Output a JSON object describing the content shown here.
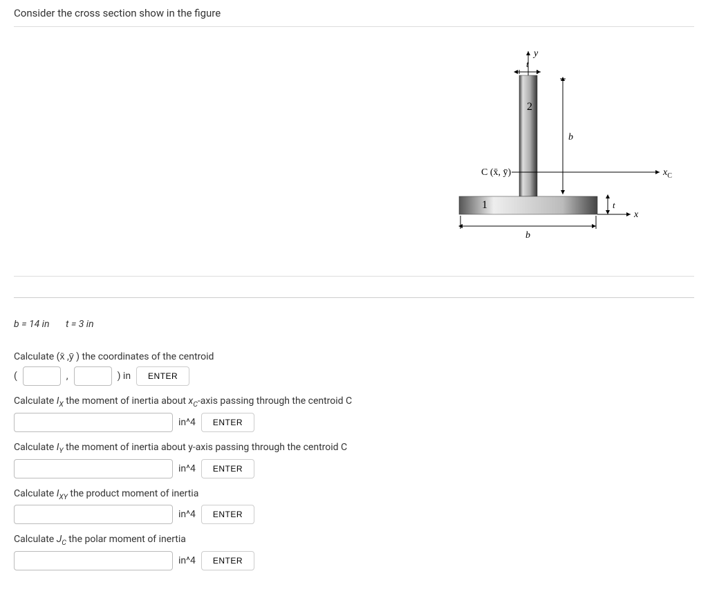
{
  "title": "Consider the cross section show in the figure",
  "given": {
    "b": "b = 14 in",
    "t": "t = 3 in"
  },
  "q1": {
    "prompt": "Calculate (x̄ ,ȳ ) the coordinates of the centroid",
    "open": "(",
    "comma": ",",
    "close": ") in",
    "enter": "ENTER"
  },
  "q2": {
    "prompt_a": "Calculate ",
    "prompt_b": "I",
    "prompt_c": "X",
    "prompt_d": " the moment of inertia about ",
    "prompt_e": "x",
    "prompt_f": "C",
    "prompt_g": "-axis passing through the centroid C",
    "unit": "in^4",
    "enter": "ENTER"
  },
  "q3": {
    "prompt_a": "Calculate ",
    "prompt_b": "I",
    "prompt_c": "Y",
    "prompt_d": " the moment of inertia about y-axis passing through the centroid C",
    "unit": "in^4",
    "enter": "ENTER"
  },
  "q4": {
    "prompt_a": "Calculate ",
    "prompt_b": "I",
    "prompt_c": "XY",
    "prompt_d": " the product moment of inertia",
    "unit": "in^4",
    "enter": "ENTER"
  },
  "q5": {
    "prompt_a": "Calculate ",
    "prompt_b": "J",
    "prompt_c": "C",
    "prompt_d": " the polar moment of inertia",
    "unit": "in^4",
    "enter": "ENTER"
  },
  "fig": {
    "y": "y",
    "t_top": "t",
    "two": "2",
    "b_right": "b",
    "c_label": "C (x̄, ȳ)",
    "xc": "x",
    "xc_sub": "C",
    "one": "1",
    "t_right": "t",
    "x": "x",
    "b_bottom": "b"
  }
}
